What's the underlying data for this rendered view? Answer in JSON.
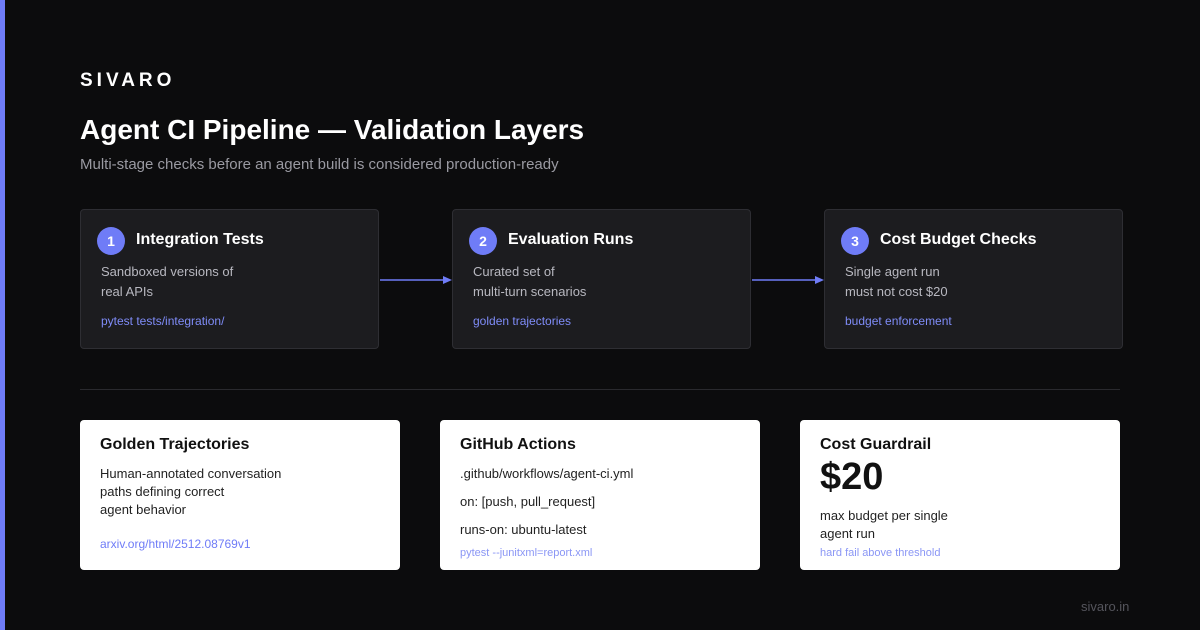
{
  "brand": "SIVARO",
  "title": "Agent CI Pipeline — Validation Layers",
  "subtitle": "Multi-stage checks before an agent build is considered production-ready",
  "stages": [
    {
      "number": "1",
      "title": "Integration Tests",
      "desc_line1": "Sandboxed versions of",
      "desc_line2": "real APIs",
      "tag": "pytest tests/integration/"
    },
    {
      "number": "2",
      "title": "Evaluation Runs",
      "desc_line1": "Curated set of",
      "desc_line2": "multi-turn scenarios",
      "tag": "golden trajectories"
    },
    {
      "number": "3",
      "title": "Cost Budget Checks",
      "desc_line1": "Single agent run",
      "desc_line2": "must not cost $20",
      "tag": "budget enforcement"
    }
  ],
  "cards": {
    "golden": {
      "title": "Golden Trajectories",
      "line1": "Human-annotated conversation",
      "line2": "paths defining correct",
      "line3": "agent behavior",
      "link": "arxiv.org/html/2512.08769v1"
    },
    "github": {
      "title": "GitHub Actions",
      "line1": ".github/workflows/agent-ci.yml",
      "line2": "on: [push, pull_request]",
      "line3": "runs-on: ubuntu-latest",
      "foot": "pytest --junitxml=report.xml"
    },
    "cost": {
      "title": "Cost Guardrail",
      "value": "$20",
      "line1": "max budget per single",
      "line2": "agent run",
      "foot": "hard fail above threshold"
    }
  },
  "footer": "sivaro.in",
  "colors": {
    "accent": "#6f7cf7",
    "background": "#0c0c0d",
    "stage_bg": "#1c1c1f",
    "card_bg": "#ffffff"
  }
}
